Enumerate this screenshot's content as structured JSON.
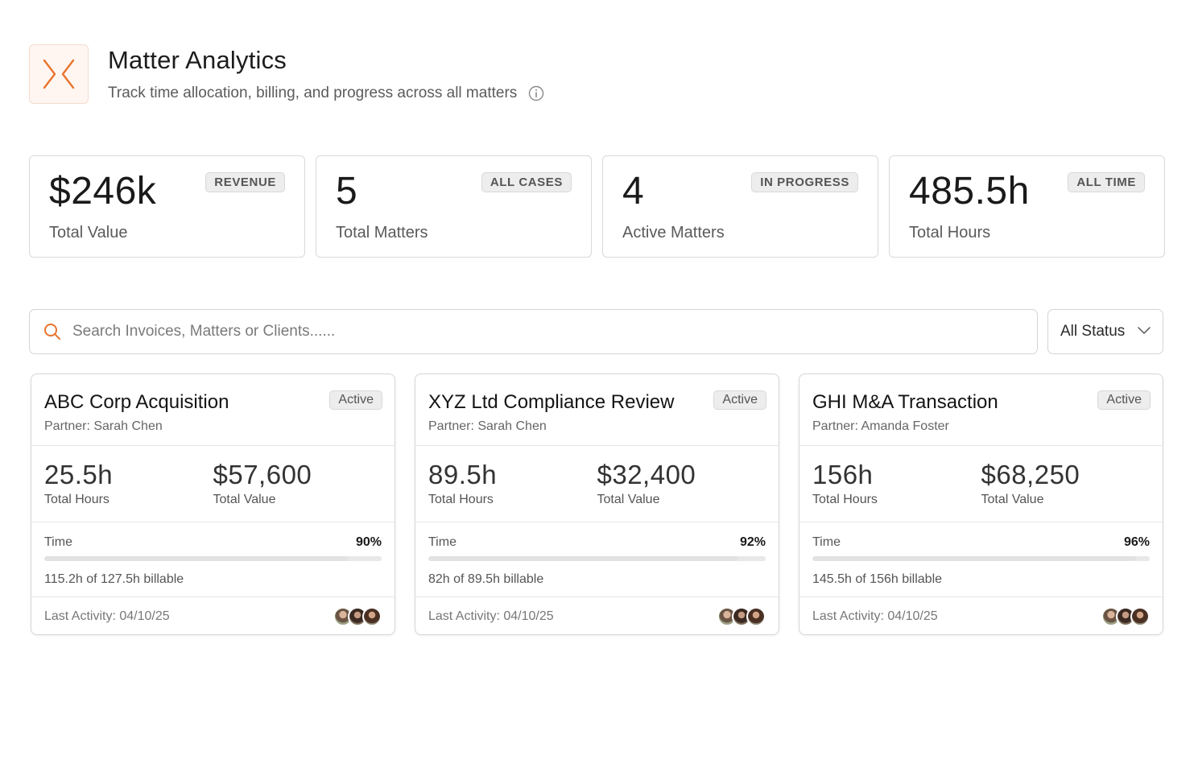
{
  "header": {
    "title": "Matter Analytics",
    "subtitle": "Track time allocation, billing, and progress across all matters",
    "logo_icon": "chevrons-collapse-icon",
    "accent_color": "#e8742f"
  },
  "stats": [
    {
      "value": "$246k",
      "label": "Total Value",
      "badge": "REVENUE"
    },
    {
      "value": "5",
      "label": "Total Matters",
      "badge": "ALL CASES"
    },
    {
      "value": "4",
      "label": "Active Matters",
      "badge": "IN PROGRESS"
    },
    {
      "value": "485.5h",
      "label": "Total Hours",
      "badge": "ALL TIME"
    }
  ],
  "search": {
    "placeholder": "Search Invoices, Matters or Clients......",
    "value": ""
  },
  "status_filter": {
    "selected": "All Status"
  },
  "matters": [
    {
      "title": "ABC Corp Acquisition",
      "partner": "Partner: Sarah Chen",
      "status": "Active",
      "hours": "25.5h",
      "hours_label": "Total Hours",
      "value": "$57,600",
      "value_label": "Total Value",
      "progress_label": "Time",
      "progress_pct": "90%",
      "progress_fraction": 0.9,
      "billable": "115.2h of 127.5h billable",
      "last_activity": "Last Activity: 04/10/25"
    },
    {
      "title": "XYZ Ltd Compliance Review",
      "partner": "Partner: Sarah Chen",
      "status": "Active",
      "hours": "89.5h",
      "hours_label": "Total Hours",
      "value": "$32,400",
      "value_label": "Total Value",
      "progress_label": "Time",
      "progress_pct": "92%",
      "progress_fraction": 0.92,
      "billable": "82h of 89.5h billable",
      "last_activity": "Last Activity: 04/10/25"
    },
    {
      "title": "GHI M&A Transaction",
      "partner": "Partner: Amanda Foster",
      "status": "Active",
      "hours": "156h",
      "hours_label": "Total Hours",
      "value": "$68,250",
      "value_label": "Total Value",
      "progress_label": "Time",
      "progress_pct": "96%",
      "progress_fraction": 0.96,
      "billable": "145.5h of 156h billable",
      "last_activity": "Last Activity: 04/10/25"
    }
  ]
}
